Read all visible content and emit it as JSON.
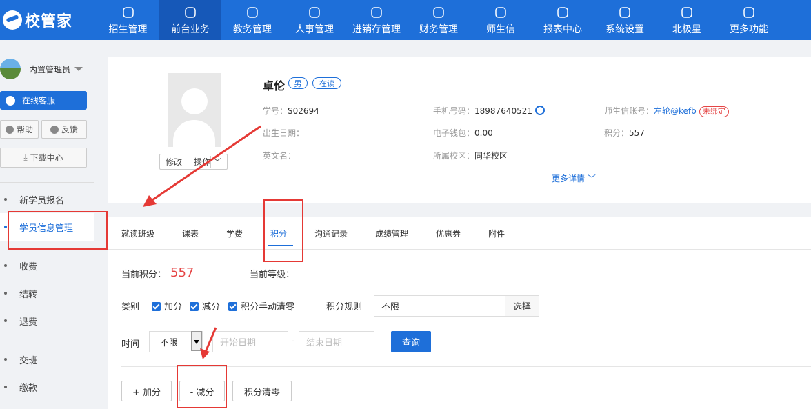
{
  "app": {
    "logo_text": "校管家"
  },
  "nav": [
    {
      "label": "招生管理",
      "icon": "user-add-icon"
    },
    {
      "label": "前台业务",
      "icon": "desk-icon",
      "active": true
    },
    {
      "label": "教务管理",
      "icon": "book-icon"
    },
    {
      "label": "人事管理",
      "icon": "person-icon"
    },
    {
      "label": "进销存管理",
      "icon": "inventory-icon"
    },
    {
      "label": "财务管理",
      "icon": "finance-icon"
    },
    {
      "label": "师生信",
      "icon": "chat-icon"
    },
    {
      "label": "报表中心",
      "icon": "report-icon"
    },
    {
      "label": "系统设置",
      "icon": "settings-icon"
    },
    {
      "label": "北极星",
      "icon": "star-icon"
    },
    {
      "label": "更多功能",
      "icon": "more-icon"
    }
  ],
  "sidebar": {
    "user_name": "内置管理员",
    "service": "在线客服",
    "help": "帮助",
    "feedback": "反馈",
    "download": "下载中心",
    "items": [
      {
        "label": "新学员报名"
      },
      {
        "label": "学员信息管理",
        "active": true
      },
      {
        "label": "收费"
      },
      {
        "label": "结转"
      },
      {
        "label": "退费"
      },
      {
        "label": "交班"
      },
      {
        "label": "缴款"
      }
    ]
  },
  "student": {
    "name": "卓伦",
    "gender": "男",
    "status": "在读",
    "modify": "修改",
    "ops": "操作",
    "id_label": "学号：",
    "id": "S02694",
    "birth_label": "出生日期：",
    "en_label": "英文名：",
    "phone_label": "手机号码：",
    "phone": "18987640521",
    "wallet_label": "电子钱包：",
    "wallet": "0.00",
    "campus_label": "所属校区：",
    "campus": "同华校区",
    "account_label": "师生信账号：",
    "account": "左轮@kefb",
    "bind_status": "未绑定",
    "points_label": "积分：",
    "points": "557",
    "more": "更多详情"
  },
  "tabs": [
    "就读班级",
    "课表",
    "学费",
    "积分",
    "沟通记录",
    "成绩管理",
    "优惠券",
    "附件"
  ],
  "points_panel": {
    "current_label": "当前积分：",
    "current": "557",
    "level_label": "当前等级：",
    "category_label": "类别",
    "checks": [
      "加分",
      "减分",
      "积分手动清零"
    ],
    "rule_label": "积分规则",
    "rule_value": "不限",
    "select": "选择",
    "time_label": "时间",
    "time_value": "不限",
    "start_ph": "开始日期",
    "dash": "-",
    "end_ph": "结束日期",
    "query": "查询",
    "add": "+ 加分",
    "minus": "- 减分",
    "clear": "积分清零"
  },
  "colors": {
    "primary": "#1e6fd9",
    "highlight": "#e54545"
  }
}
